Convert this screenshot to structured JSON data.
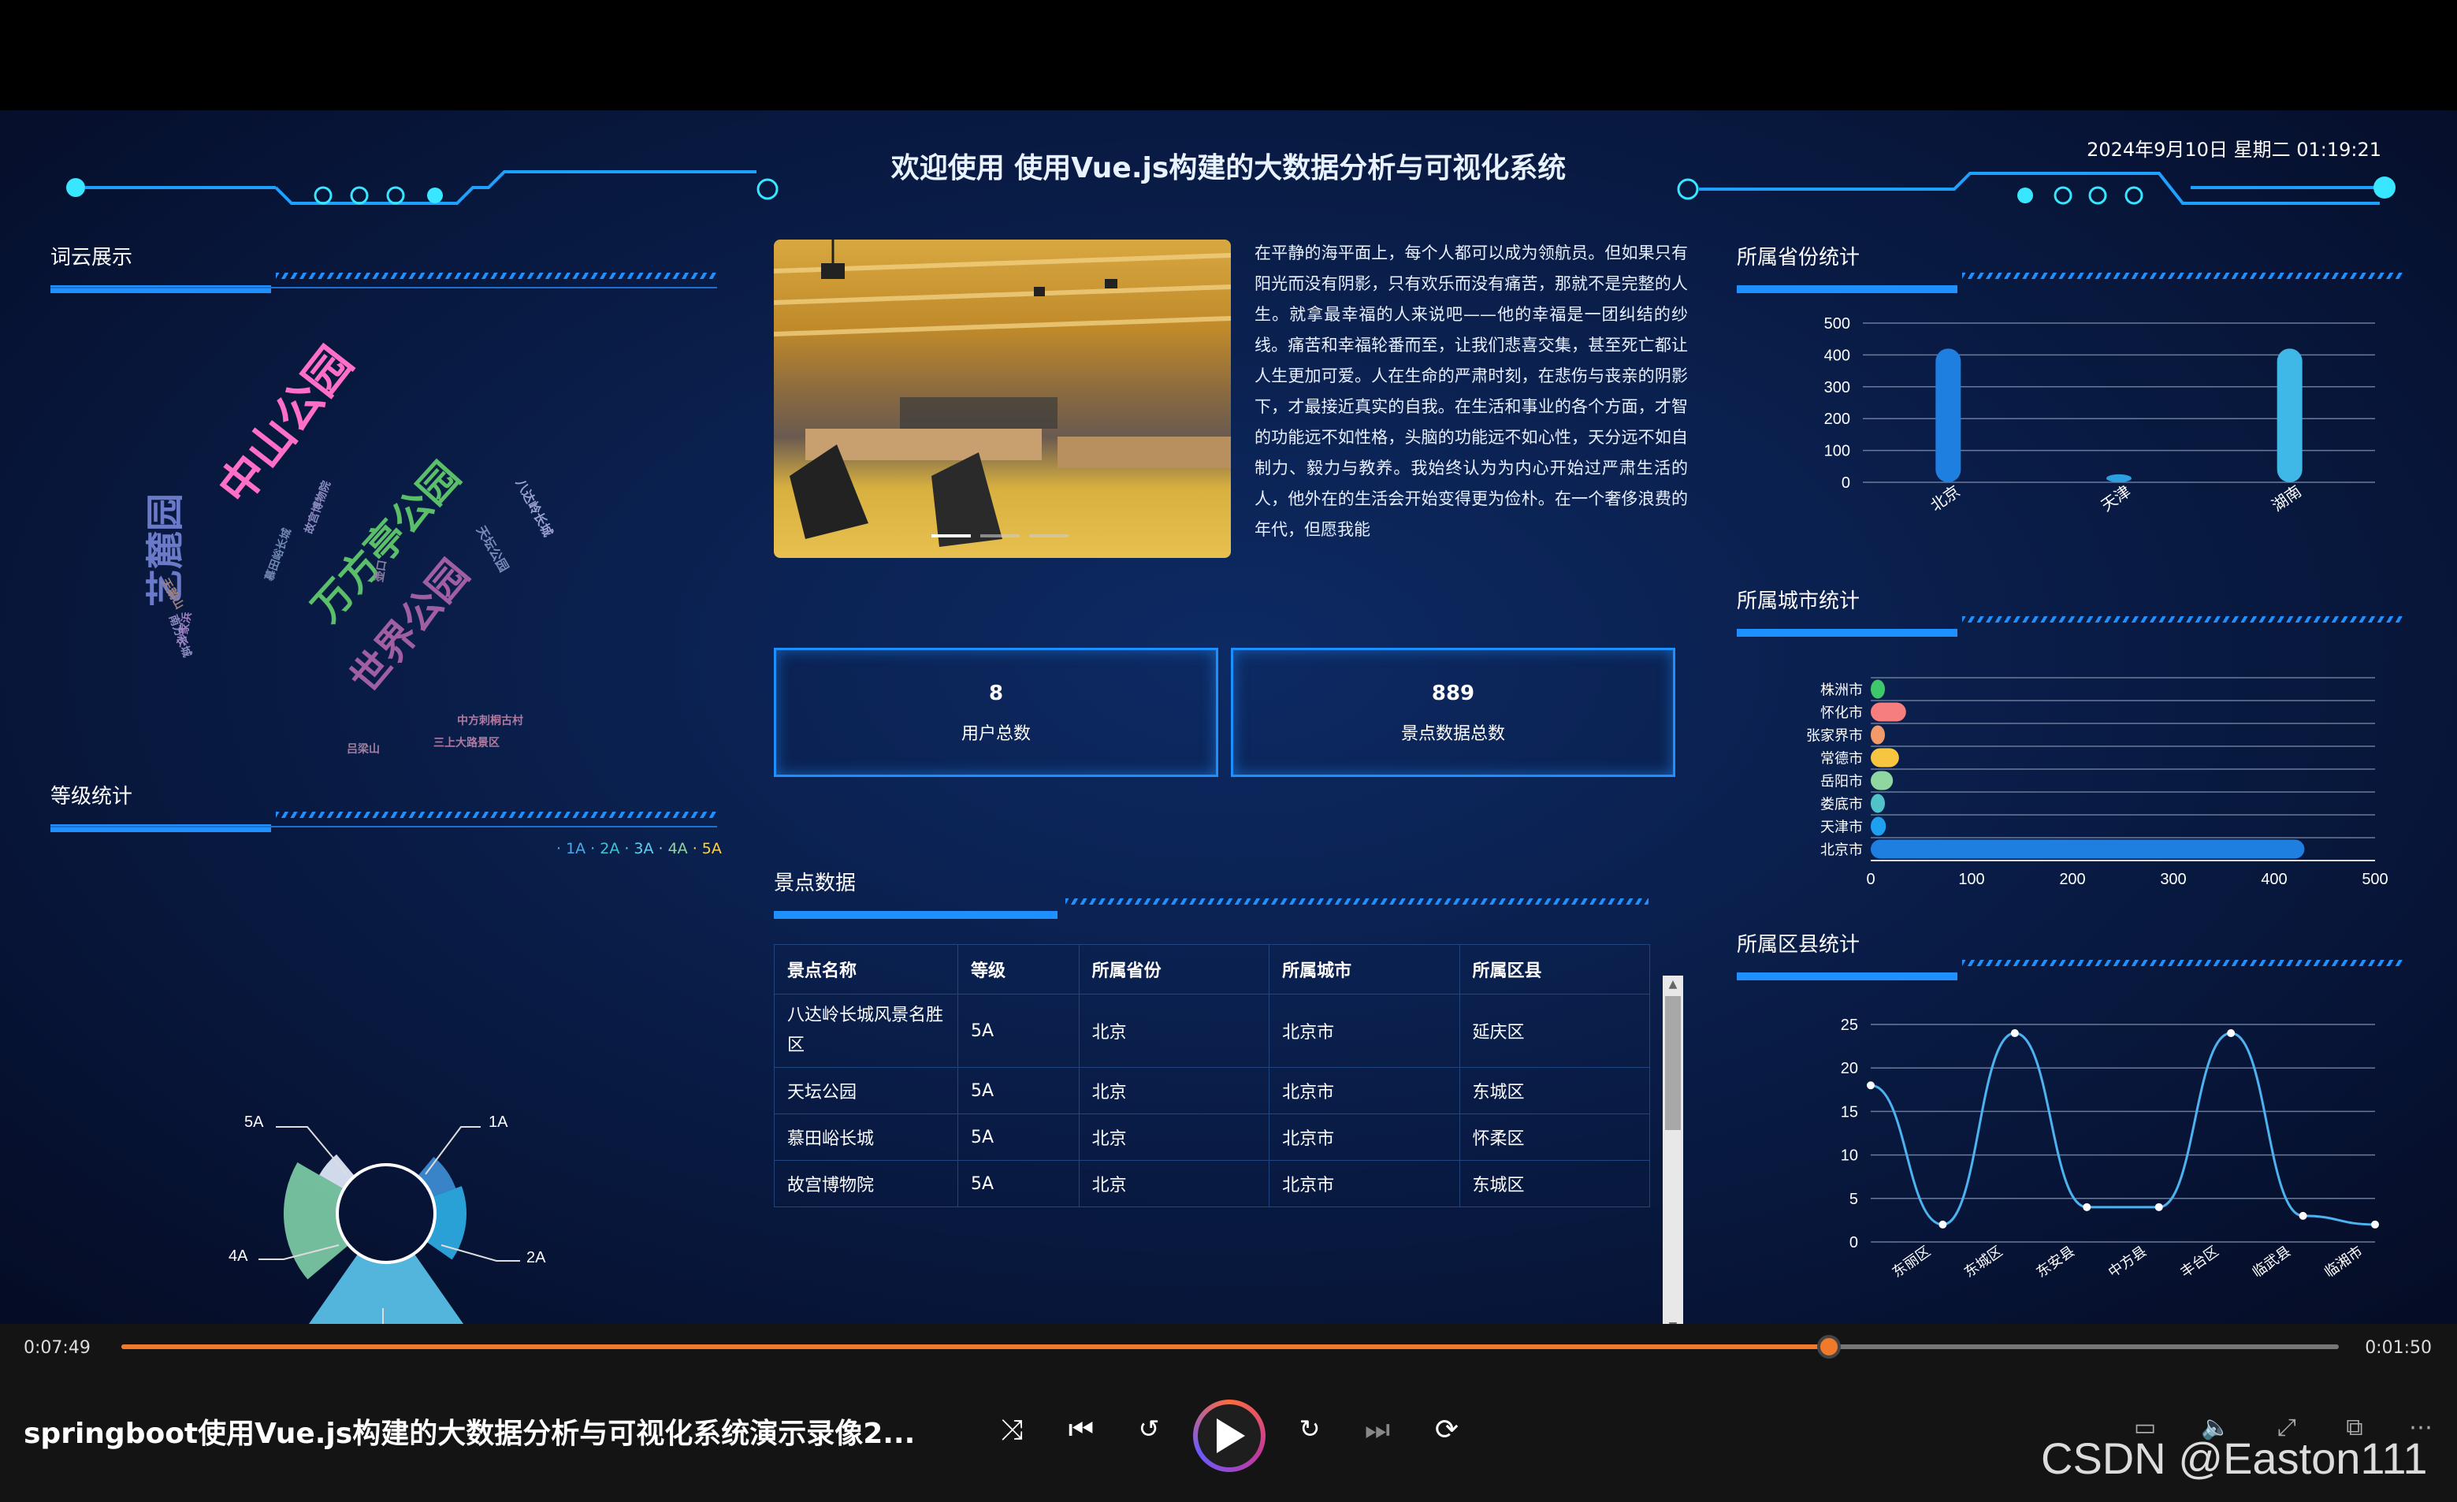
{
  "header": {
    "title": "欢迎使用 使用Vue.js构建的大数据分析与可视化系统",
    "datetime": "2024年9月10日 星期二 01:19:21"
  },
  "panels": {
    "wordcloud": "词云展示",
    "level": "等级统计",
    "province": "所属省份统计",
    "city": "所属城市统计",
    "county": "所属区县统计",
    "spots": "景点数据"
  },
  "wordcloud_words": [
    {
      "text": "中山公园",
      "color": "#ff6ec7"
    },
    {
      "text": "万方亭公园",
      "color": "#5bbf6a"
    },
    {
      "text": "世界公园",
      "color": "#a05fa0"
    },
    {
      "text": "艺麓园",
      "color": "#6a7ac8"
    },
    {
      "text": "八达岭长城",
      "color": "#9aa0d0"
    },
    {
      "text": "天坛公园",
      "color": "#7a8ab8"
    },
    {
      "text": "故宫博物院",
      "color": "#8a8ac0"
    },
    {
      "text": "慕田峪长城",
      "color": "#7088b0"
    },
    {
      "text": "中方刺桐古村",
      "color": "#b07aa0"
    },
    {
      "text": "三上大路景区",
      "color": "#b07aa0"
    },
    {
      "text": "吕梁山",
      "color": "#a080a0"
    },
    {
      "text": "天鹅山",
      "color": "#a08080"
    },
    {
      "text": "南方长城",
      "color": "#8a8ac0"
    },
    {
      "text": "壶口",
      "color": "#9080a0"
    },
    {
      "text": "沙家浜",
      "color": "#a080c0"
    }
  ],
  "level_legend": [
    "1A",
    "2A",
    "3A",
    "4A",
    "5A"
  ],
  "level_legend_colors": [
    "#4fa8e8",
    "#3fc6d8",
    "#60d0f0",
    "#8fd6a0",
    "#ffd24a"
  ],
  "level_labels": [
    "5A",
    "1A",
    "4A",
    "2A",
    "3A"
  ],
  "story": "在平静的海平面上，每个人都可以成为领航员。但如果只有阳光而没有阴影，只有欢乐而没有痛苦，那就不是完整的人生。就拿最幸福的人来说吧——他的幸福是一团纠结的纱线。痛苦和幸福轮番而至，让我们悲喜交集，甚至死亡都让人生更加可爱。人在生命的严肃时刻，在悲伤与丧亲的阴影下，才最接近真实的自我。在生活和事业的各个方面，才智的功能远不如性格，头脑的功能远不如心性，天分远不如自制力、毅力与教养。我始终认为为内心开始过严肃生活的人，他外在的生活会开始变得更为俭朴。在一个奢侈浪费的年代，但愿我能",
  "stats": [
    {
      "value": "8",
      "label": "用户总数"
    },
    {
      "value": "889",
      "label": "景点数据总数"
    }
  ],
  "table": {
    "headers": [
      "景点名称",
      "等级",
      "所属省份",
      "所属城市",
      "所属区县"
    ],
    "rows": [
      [
        "八达岭长城风景名胜区",
        "5A",
        "北京",
        "北京市",
        "延庆区"
      ],
      [
        "天坛公园",
        "5A",
        "北京",
        "北京市",
        "东城区"
      ],
      [
        "慕田峪长城",
        "5A",
        "北京",
        "北京市",
        "怀柔区"
      ],
      [
        "故宫博物院",
        "5A",
        "北京",
        "北京市",
        "东城区"
      ]
    ]
  },
  "chart_data": [
    {
      "type": "bar",
      "title": "所属省份统计",
      "categories": [
        "北京",
        "天津",
        "湖南"
      ],
      "values": [
        420,
        25,
        420
      ],
      "ylim": [
        0,
        500
      ],
      "yticks": [
        "0",
        "100",
        "200",
        "300",
        "400",
        "500"
      ],
      "colors": [
        "#1e7fe0",
        "#2aa0e0",
        "#3fb8e8"
      ]
    },
    {
      "type": "bar",
      "orientation": "horizontal",
      "title": "所属城市统计",
      "categories": [
        "株洲市",
        "怀化市",
        "张家界市",
        "常德市",
        "岳阳市",
        "娄底市",
        "天津市",
        "北京市"
      ],
      "values": [
        10,
        35,
        8,
        28,
        22,
        12,
        15,
        430
      ],
      "xlim": [
        0,
        500
      ],
      "xticks": [
        "0",
        "100",
        "200",
        "300",
        "400",
        "500"
      ],
      "colors": [
        "#3fc86b",
        "#f77e7e",
        "#f29a6a",
        "#f7c640",
        "#8fd6a0",
        "#4fc3c8",
        "#1ea0f0",
        "#1e7fe0"
      ]
    },
    {
      "type": "line",
      "title": "所属区县统计",
      "categories": [
        "东丽区",
        "东城区",
        "东安县",
        "中方县",
        "丰台区",
        "临武县",
        "临湘市"
      ],
      "values": [
        18,
        2,
        24,
        4,
        4,
        24,
        3,
        2
      ],
      "ylim": [
        0,
        25
      ],
      "yticks": [
        "0",
        "5",
        "10",
        "15",
        "20",
        "25"
      ]
    },
    {
      "type": "pie",
      "title": "等级统计",
      "categories": [
        "1A",
        "2A",
        "3A",
        "4A",
        "5A"
      ],
      "values": [
        3,
        5,
        30,
        12,
        4
      ]
    }
  ],
  "player": {
    "elapsed": "0:07:49",
    "remaining": "0:01:50",
    "progress": 0.77,
    "video_title": "springboot使用Vue.js构建的大数据分析与可视化系统演示录像2...",
    "watermark": "CSDN @Easton111"
  }
}
